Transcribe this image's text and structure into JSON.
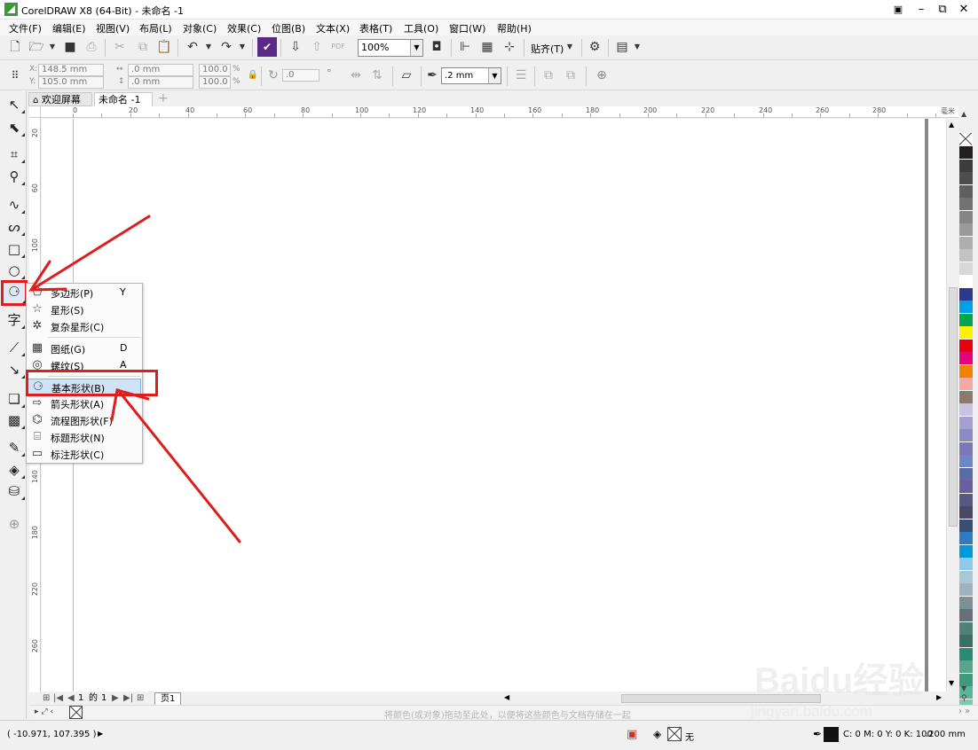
{
  "titlebar": {
    "title": "CorelDRAW X8 (64-Bit) - 未命名 -1",
    "min": "–",
    "restore": "⧉",
    "close": "✕"
  },
  "menubar": [
    "文件(F)",
    "编辑(E)",
    "视图(V)",
    "布局(L)",
    "对象(C)",
    "效果(C)",
    "位图(B)",
    "文本(X)",
    "表格(T)",
    "工具(O)",
    "窗口(W)",
    "帮助(H)"
  ],
  "toolbar1": {
    "zoom": "100%",
    "snap": "贴齐(T)"
  },
  "toolbar2": {
    "x": "148.5 mm",
    "y": "105.0 mm",
    "width": ".0 mm",
    "height": ".0 mm",
    "scale_x": "100.0",
    "scale_y": "100.0",
    "percent": "%",
    "angle": ".0",
    "degree": "°",
    "outline_width": ".2 mm"
  },
  "doctabs": {
    "welcome": "欢迎屏幕",
    "untitled": "未命名 -1",
    "add": "+"
  },
  "ruler": {
    "h": [
      "0",
      "20",
      "40",
      "60",
      "80",
      "100",
      "120",
      "140",
      "160",
      "180",
      "200",
      "220",
      "240",
      "260",
      "280"
    ],
    "unit": "毫米",
    "v": [
      "20",
      "60",
      "100",
      "140",
      "180",
      "220",
      "260"
    ]
  },
  "flyout": {
    "items": [
      {
        "icon": "polygon-icon",
        "glyph": "⬠",
        "label": "多边形(P)",
        "key": "Y"
      },
      {
        "icon": "star-icon",
        "glyph": "☆",
        "label": "星形(S)",
        "key": ""
      },
      {
        "icon": "complex-star-icon",
        "glyph": "✲",
        "label": "复杂星形(C)",
        "key": ""
      },
      {
        "icon": "graph-paper-icon",
        "glyph": "▦",
        "label": "图纸(G)",
        "key": "D"
      },
      {
        "icon": "spiral-icon",
        "glyph": "◎",
        "label": "螺纹(S)",
        "key": "A"
      },
      {
        "icon": "basic-shapes-icon",
        "glyph": "⚆",
        "label": "基本形状(B)",
        "key": ""
      },
      {
        "icon": "arrow-shapes-icon",
        "glyph": "⇨",
        "label": "箭头形状(A)",
        "key": ""
      },
      {
        "icon": "flowchart-shapes-icon",
        "glyph": "⌬",
        "label": "流程图形状(F)",
        "key": ""
      },
      {
        "icon": "banner-shapes-icon",
        "glyph": "⌸",
        "label": "标题形状(N)",
        "key": ""
      },
      {
        "icon": "callout-shapes-icon",
        "glyph": "▭",
        "label": "标注形状(C)",
        "key": ""
      }
    ]
  },
  "pagenav": {
    "current": "1",
    "of": "的",
    "total": "1",
    "page_tab": "页1"
  },
  "docpalette": {
    "hint": "将颜色(或对象)拖动至此处，以便将这些颜色与文档存储在一起"
  },
  "status": {
    "coords": "( -10.971, 107.395 )",
    "fill_none": "无",
    "outline_color": "C: 0 M: 0 Y: 0 K: 100",
    "outline_width": ".200 mm"
  },
  "palette": [
    "#231f20",
    "#3c3c3c",
    "#4d4d4d",
    "#5f5f5f",
    "#727272",
    "#868686",
    "#9a9a9a",
    "#aeaeae",
    "#c2c2c2",
    "#d7d7d7",
    "#ffffff",
    "#2a3a8f",
    "#00a0e9",
    "#00a650",
    "#fff100",
    "#e60012",
    "#e4007f",
    "#f08300",
    "#f5a8a5",
    "#8c7b6d",
    "#c9c3e3",
    "#a6a0d0",
    "#8c8ac2",
    "#7b78b7",
    "#6f86c5",
    "#5c6aa6",
    "#6a5f9a",
    "#5a5782",
    "#4a4867",
    "#3a4f70",
    "#2e7bc4",
    "#0099d9",
    "#8fc9ea",
    "#a8c8d8",
    "#9fb3bc",
    "#7e8f98",
    "#64707a",
    "#4e8278",
    "#3b7063",
    "#2a8a72",
    "#5aa48e",
    "#3d9b7c",
    "#59b69a",
    "#7ec8b0"
  ],
  "watermark": {
    "main": "Baidu经验",
    "sub": "jingyan.baidu.com"
  },
  "colors": {
    "accent_red": "#e01c1c",
    "highlight": "#cfe3f6"
  }
}
